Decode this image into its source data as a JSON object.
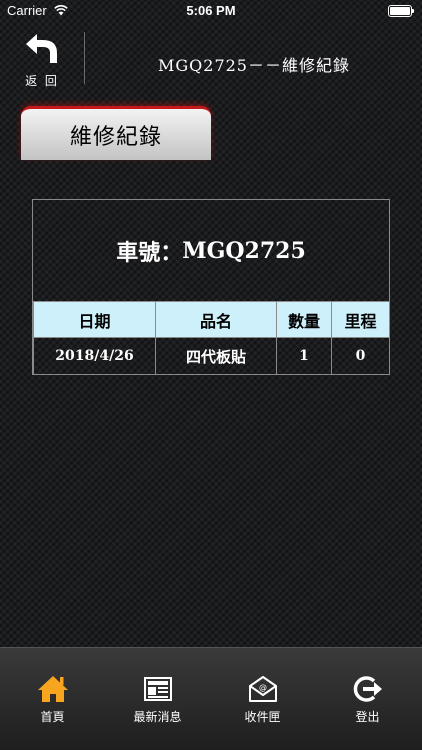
{
  "status_bar": {
    "carrier": "Carrier",
    "time": "5:06 PM"
  },
  "header": {
    "back_label": "返 回",
    "title": "MGQ2725－－維修紀錄"
  },
  "tab": {
    "label": "維修紀錄"
  },
  "plate": {
    "label": "車號：",
    "value": "MGQ2725"
  },
  "table": {
    "headers": [
      "日期",
      "品名",
      "數量",
      "里程"
    ],
    "rows": [
      [
        "2018/4/26",
        "四代板貼",
        "1",
        "0"
      ]
    ]
  },
  "tabbar": {
    "items": [
      {
        "label": "首頁",
        "icon": "home-icon"
      },
      {
        "label": "最新消息",
        "icon": "newspaper-icon"
      },
      {
        "label": "收件匣",
        "icon": "mail-icon"
      },
      {
        "label": "登出",
        "icon": "logout-icon"
      }
    ],
    "active_color": "#f7a51e"
  }
}
